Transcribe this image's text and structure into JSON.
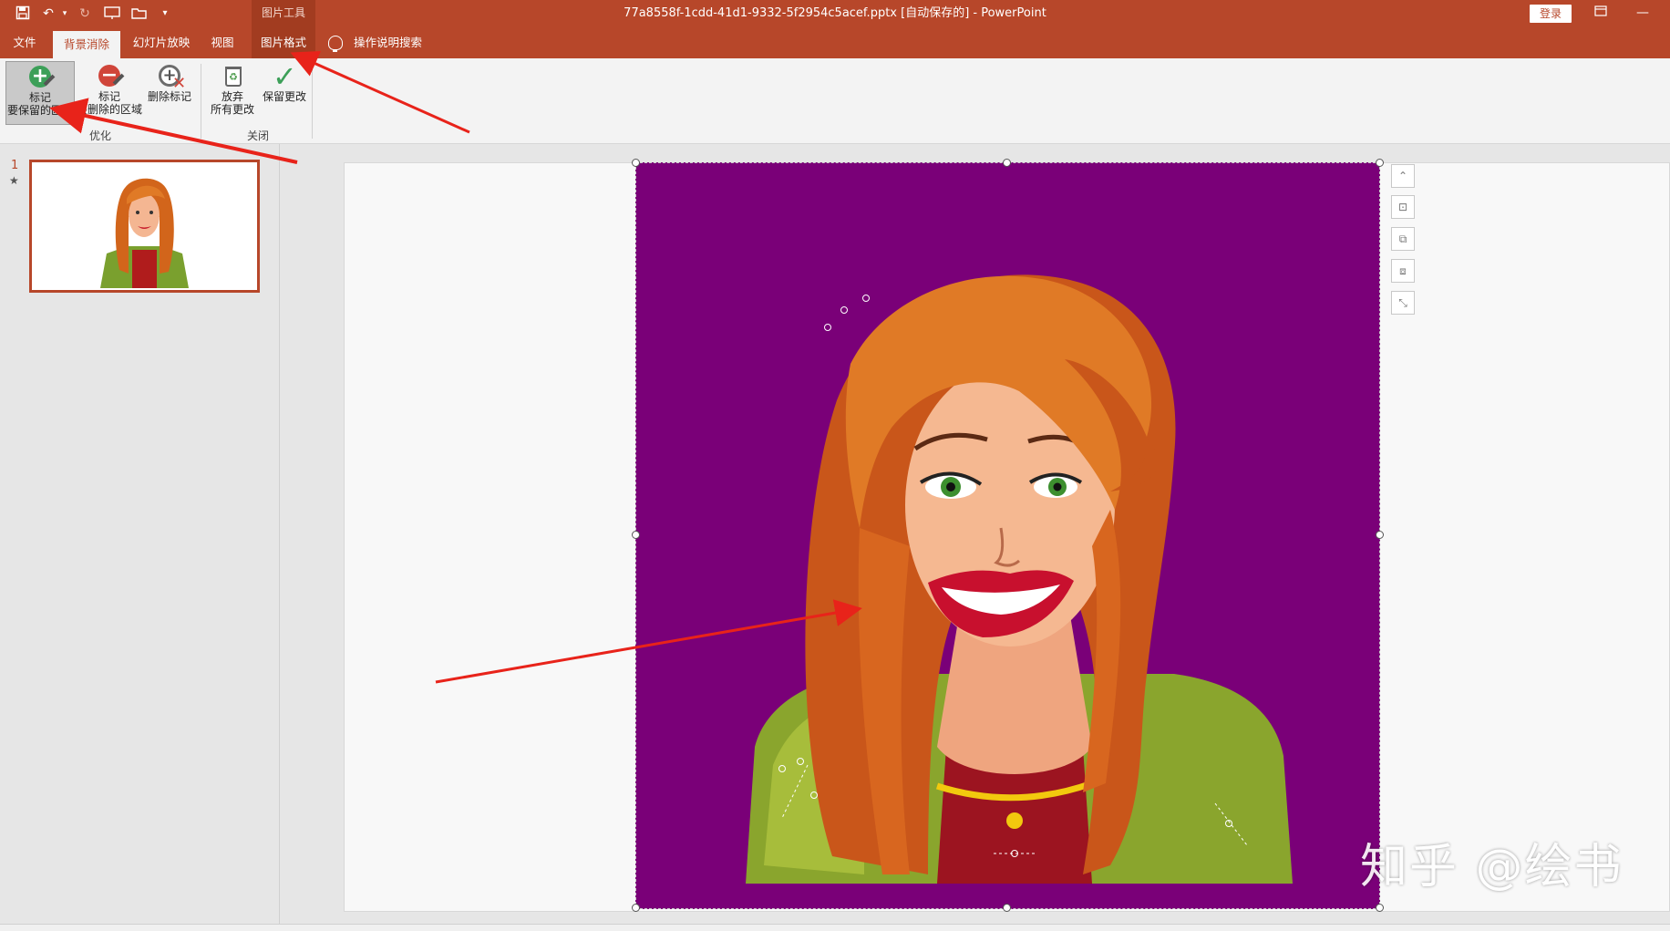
{
  "colors": {
    "brand": "#b7472a",
    "picture_background": "#7a0078",
    "annotation_arrow": "#e8231a"
  },
  "quick_access": {
    "icons": [
      "save-icon",
      "undo-icon",
      "redo-icon",
      "start-from-beginning-icon",
      "open-icon",
      "customize-qat-icon"
    ]
  },
  "contextual_group": "图片工具",
  "window": {
    "title": "77a8558f-1cdd-41d1-9332-5f2954c5acef.pptx [自动保存的]  -  PowerPoint",
    "login": "登录"
  },
  "tabs": [
    {
      "label": "文件"
    },
    {
      "label": "背景消除",
      "active": true
    },
    {
      "label": "幻灯片放映"
    },
    {
      "label": "视图"
    },
    {
      "label": "图片格式"
    }
  ],
  "tell_me": "操作说明搜索",
  "ribbon": {
    "groups": [
      {
        "label": "优化",
        "buttons": [
          {
            "label_line1": "标记",
            "label_line2": "要保留的区域",
            "icon": "mark-keep-icon"
          },
          {
            "label_line1": "标记",
            "label_line2": "要删除的区域",
            "icon": "mark-remove-icon"
          },
          {
            "label_line1": "删除标记",
            "label_line2": "",
            "icon": "delete-mark-icon"
          }
        ]
      },
      {
        "label": "关闭",
        "buttons": [
          {
            "label_line1": "放弃",
            "label_line2": "所有更改",
            "icon": "discard-icon"
          },
          {
            "label_line1": "保留更改",
            "label_line2": "",
            "icon": "keep-changes-icon"
          }
        ]
      }
    ]
  },
  "slides_pane": {
    "slide_number": "1",
    "star": "★"
  },
  "side_toolbar": [
    "collapse-icon",
    "layout-icon",
    "bring-forward-icon",
    "send-backward-icon",
    "resize-icon"
  ],
  "watermark": "知乎 @绘书"
}
